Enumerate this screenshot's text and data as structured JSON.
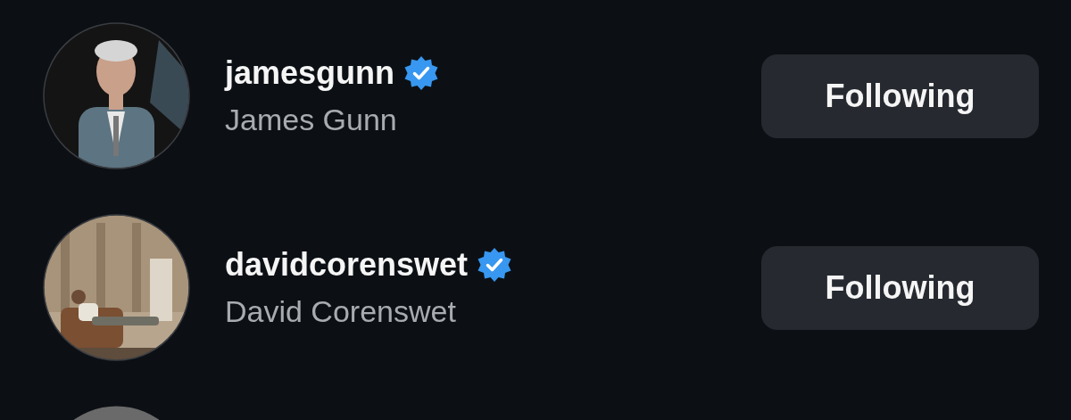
{
  "accounts": [
    {
      "username": "jamesgunn",
      "verified": true,
      "full_name": "James Gunn",
      "button": "Following"
    },
    {
      "username": "davidcorenswet",
      "verified": true,
      "full_name": "David Corenswet",
      "button": "Following"
    }
  ]
}
